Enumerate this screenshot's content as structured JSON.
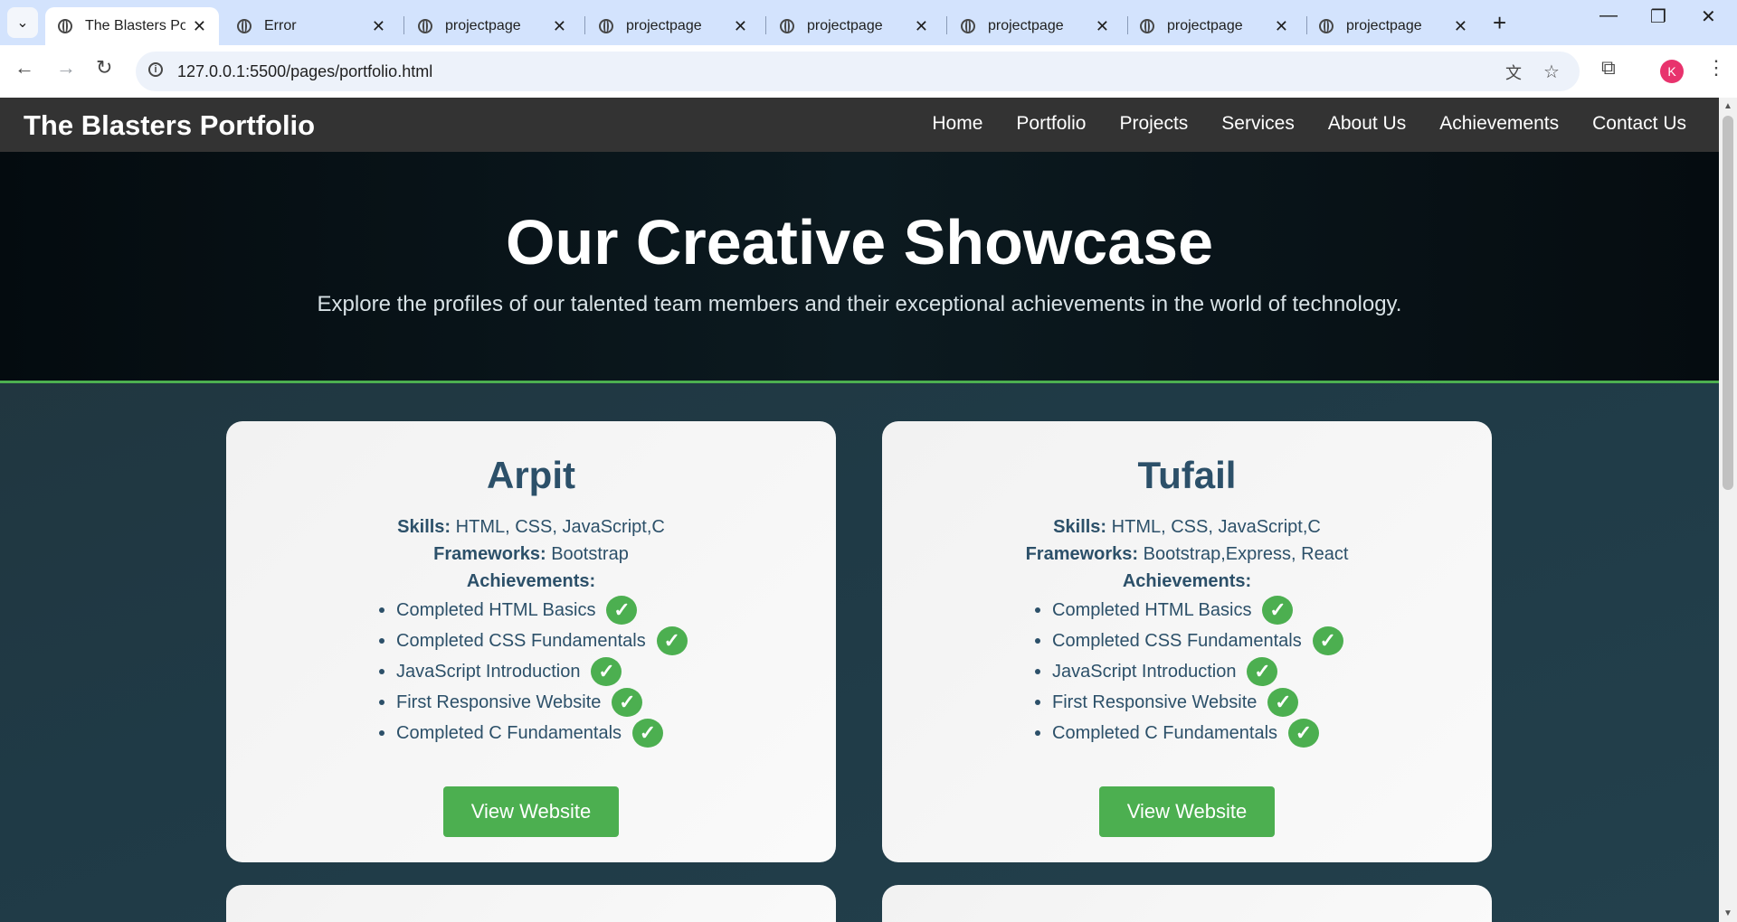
{
  "browser": {
    "tabs": [
      {
        "title": "The Blasters Port",
        "active": true
      },
      {
        "title": "Error",
        "active": false
      },
      {
        "title": "projectpage",
        "active": false
      },
      {
        "title": "projectpage",
        "active": false
      },
      {
        "title": "projectpage",
        "active": false
      },
      {
        "title": "projectpage",
        "active": false
      },
      {
        "title": "projectpage",
        "active": false
      },
      {
        "title": "projectpage",
        "active": false
      }
    ],
    "url": "127.0.0.1:5500/pages/portfolio.html",
    "profile_initial": "K"
  },
  "site": {
    "logo": "The Blasters Portfolio",
    "nav": [
      "Home",
      "Portfolio",
      "Projects",
      "Services",
      "About Us",
      "Achievements",
      "Contact Us"
    ]
  },
  "hero": {
    "title": "Our Creative Showcase",
    "subtitle": "Explore the profiles of our talented team members and their exceptional achievements in the world of technology."
  },
  "labels": {
    "skills": "Skills:",
    "frameworks": "Frameworks:",
    "achievements": "Achievements:",
    "check": "✓"
  },
  "members": [
    {
      "name": "Arpit",
      "skills": "HTML, CSS, JavaScript,C",
      "frameworks": "Bootstrap",
      "achievements": [
        "Completed HTML Basics",
        "Completed CSS Fundamentals",
        "JavaScript Introduction",
        "First Responsive Website",
        "Completed C Fundamentals"
      ],
      "button": "View Website"
    },
    {
      "name": "Tufail",
      "skills": "HTML, CSS, JavaScript,C",
      "frameworks": "Bootstrap,Express, React",
      "achievements": [
        "Completed HTML Basics",
        "Completed CSS Fundamentals",
        "JavaScript Introduction",
        "First Responsive Website",
        "Completed C Fundamentals"
      ],
      "button": "View Website"
    }
  ],
  "colors": {
    "accent_green": "#4caf50",
    "nav_bg": "#333333",
    "card_text": "#2c5069"
  }
}
